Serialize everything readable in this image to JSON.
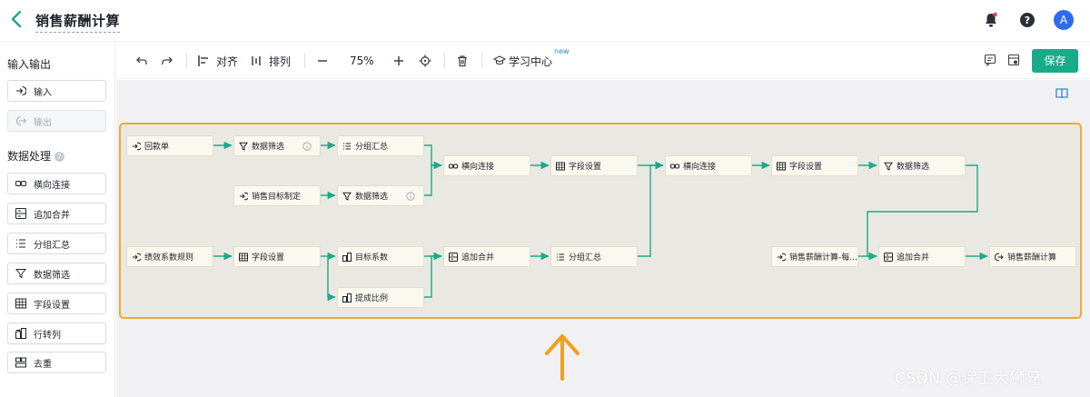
{
  "header": {
    "title": "销售薪酬计算",
    "avatar_letter": "A"
  },
  "sidebar": {
    "io_title": "输入输出",
    "io_items": [
      {
        "label": "输入",
        "icon": "input-icon"
      },
      {
        "label": "输出",
        "icon": "output-icon"
      }
    ],
    "processing_title": "数据处理",
    "processing_items": [
      {
        "label": "横向连接",
        "icon": "join-icon"
      },
      {
        "label": "追加合并",
        "icon": "append-icon"
      },
      {
        "label": "分组汇总",
        "icon": "group-icon"
      },
      {
        "label": "数据筛选",
        "icon": "filter-icon"
      },
      {
        "label": "字段设置",
        "icon": "field-settings-icon"
      },
      {
        "label": "行转列",
        "icon": "pivot-icon"
      },
      {
        "label": "去重",
        "icon": "dedupe-icon"
      }
    ]
  },
  "toolbar": {
    "align_label": "对齐",
    "arrange_label": "排列",
    "zoom": "75%",
    "learn_label": "学习中心",
    "new_tag": "new",
    "save_label": "保存"
  },
  "flow": {
    "nodes": {
      "n1": "回款单",
      "n2": "数据筛选",
      "n3": "分组汇总",
      "n4": "横向连接",
      "n5": "字段设置",
      "n6": "横向连接",
      "n7": "字段设置",
      "n8": "数据筛选",
      "n9": "销售目标制定",
      "n10": "数据筛选",
      "n11": "绩效系数规则",
      "n12": "字段设置",
      "n13": "目标系数",
      "n14": "追加合并",
      "n15": "分组汇总",
      "n16": "提成比例",
      "n17": "销售薪酬计算-每...",
      "n18": "追加合并",
      "n19": "销售薪酬计算"
    }
  },
  "watermark": "CSDN @保卫大狮兄",
  "colors": {
    "accent": "#1aaa8a",
    "frame": "#f0a73a",
    "edge": "#1aaa8a",
    "arrow": "#f0a020"
  }
}
